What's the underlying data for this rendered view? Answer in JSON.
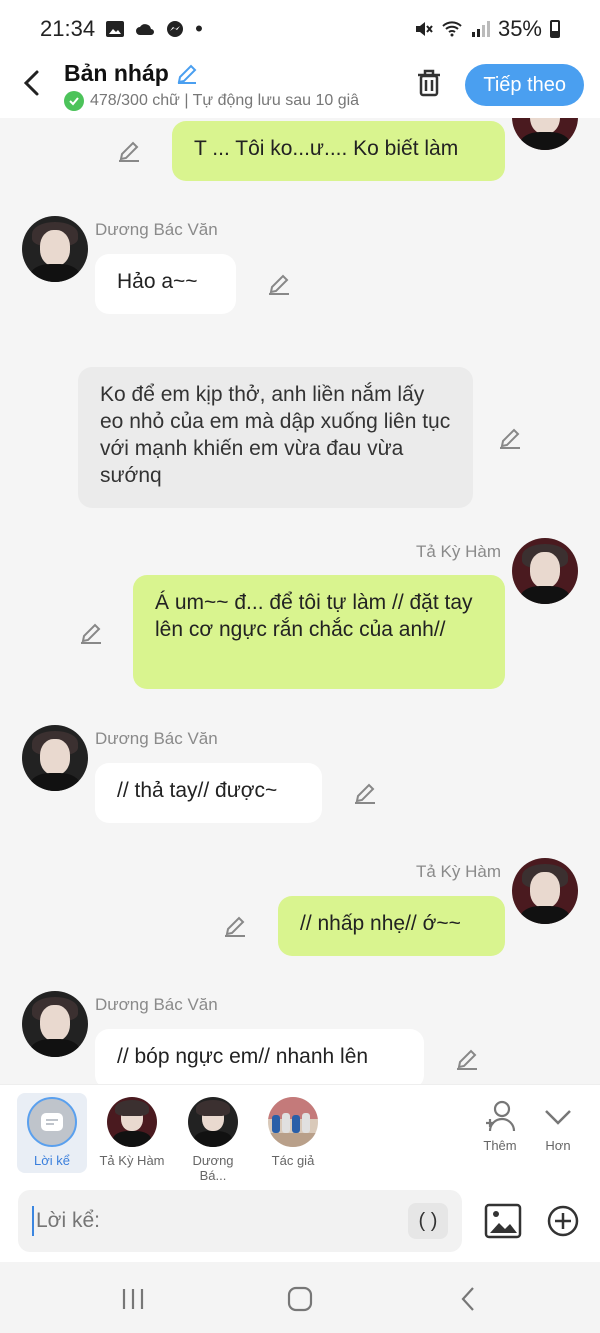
{
  "status": {
    "time": "21:34",
    "battery": "35%",
    "dot": "•"
  },
  "header": {
    "title": "Bản nháp",
    "subtitle": "478/300 chữ | Tự động lưu sau 10 giâ",
    "next_label": "Tiếp theo"
  },
  "messages": [
    {
      "side": "right",
      "text": "T ... Tôi ko...ư.... Ko biết làm"
    },
    {
      "side": "left",
      "speaker": "Dương Bác Văn",
      "text": "Hảo a~~"
    },
    {
      "side": "narration",
      "text": "Ko để em kịp thở, anh liền nắm lấy eo nhỏ của em mà dập xuống liên tục với mạnh khiến em vừa đau vừa sướnq"
    },
    {
      "side": "right",
      "speaker": "Tả Kỳ Hàm",
      "text": "Á um~~ đ... để tôi tự làm // đặt tay lên cơ ngực rắn chắc của anh//"
    },
    {
      "side": "left",
      "speaker": "Dương Bác Văn",
      "text": "// thả tay// được~"
    },
    {
      "side": "right",
      "speaker": "Tả Kỳ Hàm",
      "text": "// nhấp nhẹ// ớ~~"
    },
    {
      "side": "left",
      "speaker": "Dương Bác Văn",
      "text": "// bóp ngực em// nhanh lên"
    }
  ],
  "characters": [
    {
      "label": "Lời kể",
      "selected": true
    },
    {
      "label": "Tả Kỳ Hàm"
    },
    {
      "label": "Dương Bá..."
    },
    {
      "label": "Tác giả"
    }
  ],
  "tools": {
    "add_label": "Thêm",
    "more_label": "Hơn"
  },
  "input": {
    "placeholder": "Lời kể:",
    "paren_label": "( )"
  },
  "colors": {
    "accent": "#4a9ff0",
    "right_bubble": "#d9f48f",
    "left_bubble": "#ffffff",
    "narration_bubble": "#ebebeb",
    "check_green": "#4cc35a"
  }
}
